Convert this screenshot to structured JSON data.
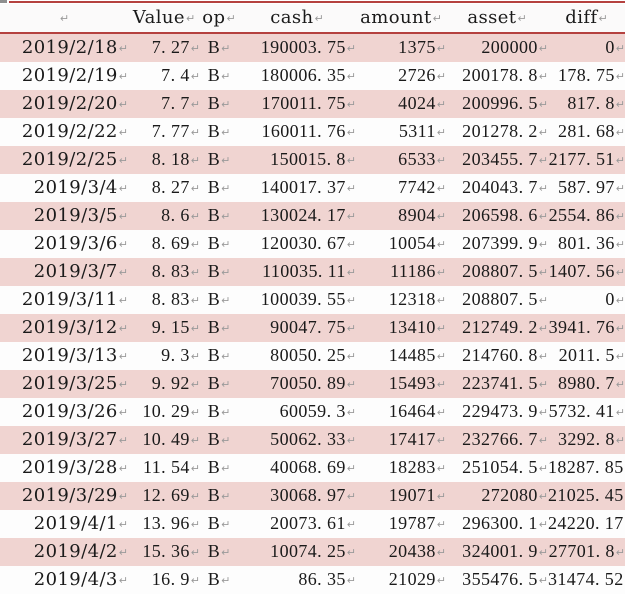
{
  "document": {
    "type": "word-table",
    "formatting_mark": "↵",
    "colors": {
      "row_shade": "#F0D4D1",
      "row_plain": "#FDFDFD",
      "header_rule": "#B5413F",
      "text": "#1a1a1a",
      "mark": "#9a9a9a"
    }
  },
  "table": {
    "columns": [
      {
        "key": "date",
        "label": ""
      },
      {
        "key": "value",
        "label": "Value"
      },
      {
        "key": "op",
        "label": "op"
      },
      {
        "key": "cash",
        "label": "cash"
      },
      {
        "key": "amount",
        "label": "amount"
      },
      {
        "key": "asset",
        "label": "asset"
      },
      {
        "key": "diff",
        "label": "diff"
      }
    ],
    "rows": [
      {
        "date": "2019/2/18",
        "value": "7. 27",
        "op": "B",
        "cash": "190003. 75",
        "amount": "1375",
        "asset": "200000",
        "diff": "0"
      },
      {
        "date": "2019/2/19",
        "value": "7. 4",
        "op": "B",
        "cash": "180006. 35",
        "amount": "2726",
        "asset": "200178. 8",
        "diff": "178. 75"
      },
      {
        "date": "2019/2/20",
        "value": "7. 7",
        "op": "B",
        "cash": "170011. 75",
        "amount": "4024",
        "asset": "200996. 5",
        "diff": "817. 8"
      },
      {
        "date": "2019/2/22",
        "value": "7. 77",
        "op": "B",
        "cash": "160011. 76",
        "amount": "5311",
        "asset": "201278. 2",
        "diff": "281. 68"
      },
      {
        "date": "2019/2/25",
        "value": "8. 18",
        "op": "B",
        "cash": "150015. 8",
        "amount": "6533",
        "asset": "203455. 7",
        "diff": "2177. 51"
      },
      {
        "date": "2019/3/4",
        "value": "8. 27",
        "op": "B",
        "cash": "140017. 37",
        "amount": "7742",
        "asset": "204043. 7",
        "diff": "587. 97"
      },
      {
        "date": "2019/3/5",
        "value": "8. 6",
        "op": "B",
        "cash": "130024. 17",
        "amount": "8904",
        "asset": "206598. 6",
        "diff": "2554. 86"
      },
      {
        "date": "2019/3/6",
        "value": "8. 69",
        "op": "B",
        "cash": "120030. 67",
        "amount": "10054",
        "asset": "207399. 9",
        "diff": "801. 36"
      },
      {
        "date": "2019/3/7",
        "value": "8. 83",
        "op": "B",
        "cash": "110035. 11",
        "amount": "11186",
        "asset": "208807. 5",
        "diff": "1407. 56"
      },
      {
        "date": "2019/3/11",
        "value": "8. 83",
        "op": "B",
        "cash": "100039. 55",
        "amount": "12318",
        "asset": "208807. 5",
        "diff": "0"
      },
      {
        "date": "2019/3/12",
        "value": "9. 15",
        "op": "B",
        "cash": "90047. 75",
        "amount": "13410",
        "asset": "212749. 2",
        "diff": "3941. 76"
      },
      {
        "date": "2019/3/13",
        "value": "9. 3",
        "op": "B",
        "cash": "80050. 25",
        "amount": "14485",
        "asset": "214760. 8",
        "diff": "2011. 5"
      },
      {
        "date": "2019/3/25",
        "value": "9. 92",
        "op": "B",
        "cash": "70050. 89",
        "amount": "15493",
        "asset": "223741. 5",
        "diff": "8980. 7"
      },
      {
        "date": "2019/3/26",
        "value": "10. 29",
        "op": "B",
        "cash": "60059. 3",
        "amount": "16464",
        "asset": "229473. 9",
        "diff": "5732. 41"
      },
      {
        "date": "2019/3/27",
        "value": "10. 49",
        "op": "B",
        "cash": "50062. 33",
        "amount": "17417",
        "asset": "232766. 7",
        "diff": "3292. 8"
      },
      {
        "date": "2019/3/28",
        "value": "11. 54",
        "op": "B",
        "cash": "40068. 69",
        "amount": "18283",
        "asset": "251054. 5",
        "diff": "18287. 85"
      },
      {
        "date": "2019/3/29",
        "value": "12. 69",
        "op": "B",
        "cash": "30068. 97",
        "amount": "19071",
        "asset": "272080",
        "diff": "21025. 45"
      },
      {
        "date": "2019/4/1",
        "value": "13. 96",
        "op": "B",
        "cash": "20073. 61",
        "amount": "19787",
        "asset": "296300. 1",
        "diff": "24220. 17"
      },
      {
        "date": "2019/4/2",
        "value": "15. 36",
        "op": "B",
        "cash": "10074. 25",
        "amount": "20438",
        "asset": "324001. 9",
        "diff": "27701. 8"
      },
      {
        "date": "2019/4/3",
        "value": "16. 9",
        "op": "B",
        "cash": "86. 35",
        "amount": "21029",
        "asset": "355476. 5",
        "diff": "31474. 52"
      }
    ]
  }
}
